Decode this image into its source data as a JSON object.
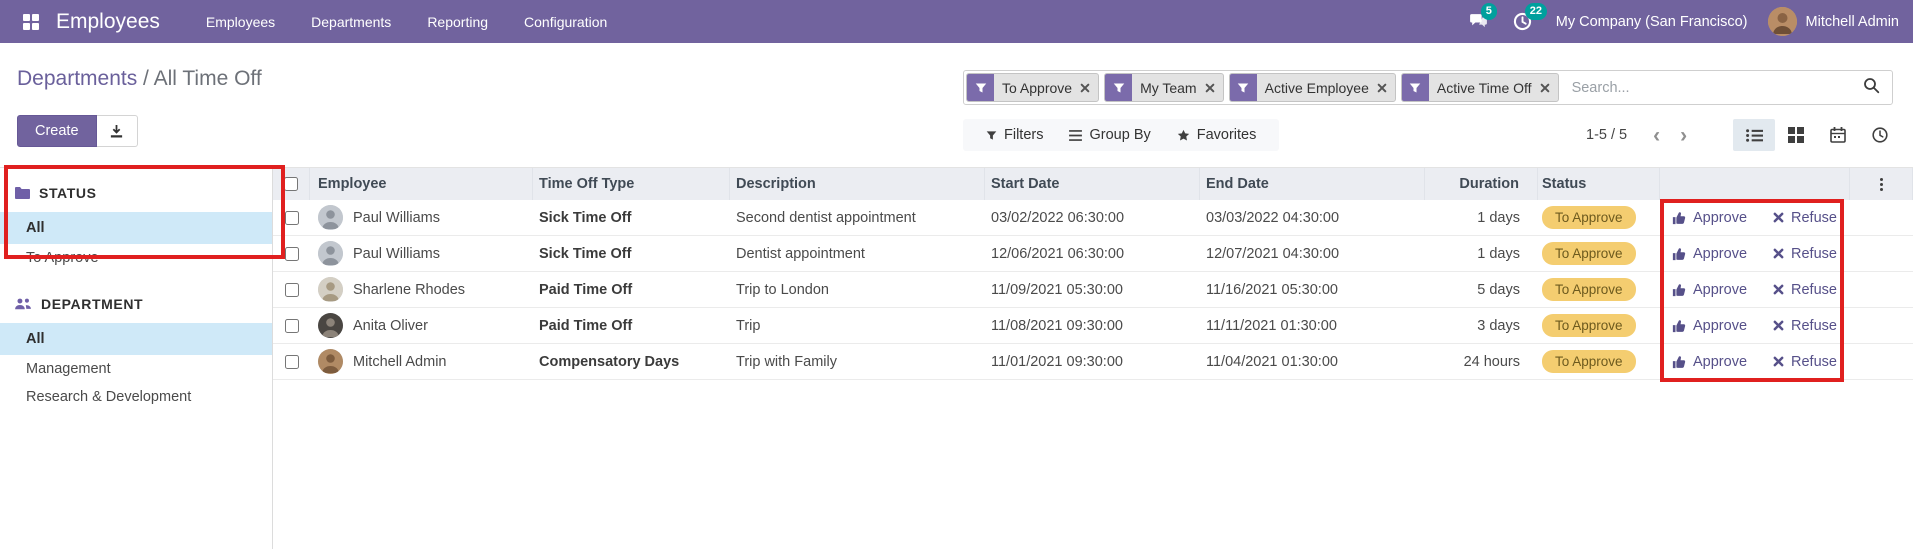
{
  "topbar": {
    "brand": "Employees",
    "menus": [
      "Employees",
      "Departments",
      "Reporting",
      "Configuration"
    ],
    "messages_count": "5",
    "activities_count": "22",
    "company": "My Company (San Francisco)",
    "user": "Mitchell Admin"
  },
  "breadcrumb": {
    "parent": "Departments",
    "separator": " / ",
    "current": "All Time Off"
  },
  "actions": {
    "create_label": "Create"
  },
  "search": {
    "placeholder": "Search...",
    "facets": [
      {
        "label": "To Approve"
      },
      {
        "label": "My Team"
      },
      {
        "label": "Active Employee"
      },
      {
        "label": "Active Time Off"
      }
    ]
  },
  "toolbar": {
    "filters": "Filters",
    "group_by": "Group By",
    "favorites": "Favorites",
    "pager_range": "1-5 / 5"
  },
  "sidebar": {
    "sections": [
      {
        "title": "STATUS",
        "icon": "folder-icon",
        "items": [
          {
            "label": "All",
            "active": true
          },
          {
            "label": "To Approve",
            "active": false
          }
        ]
      },
      {
        "title": "DEPARTMENT",
        "icon": "users-icon",
        "items": [
          {
            "label": "All",
            "active": true
          },
          {
            "label": "Management",
            "active": false
          },
          {
            "label": "Research & Development",
            "active": false
          }
        ]
      }
    ]
  },
  "table": {
    "columns": [
      "Employee",
      "Time Off Type",
      "Description",
      "Start Date",
      "End Date",
      "Duration",
      "Status"
    ],
    "row_actions": {
      "approve": "Approve",
      "refuse": "Refuse"
    },
    "rows": [
      {
        "employee": "Paul Williams",
        "type": "Sick Time Off",
        "description": "Second dentist appointment",
        "start": "03/02/2022 06:30:00",
        "end": "03/03/2022 04:30:00",
        "duration": "1 days",
        "status": "To Approve"
      },
      {
        "employee": "Paul Williams",
        "type": "Sick Time Off",
        "description": "Dentist appointment",
        "start": "12/06/2021 06:30:00",
        "end": "12/07/2021 04:30:00",
        "duration": "1 days",
        "status": "To Approve"
      },
      {
        "employee": "Sharlene Rhodes",
        "type": "Paid Time Off",
        "description": "Trip to London",
        "start": "11/09/2021 05:30:00",
        "end": "11/16/2021 05:30:00",
        "duration": "5 days",
        "status": "To Approve"
      },
      {
        "employee": "Anita Oliver",
        "type": "Paid Time Off",
        "description": "Trip",
        "start": "11/08/2021 09:30:00",
        "end": "11/11/2021 01:30:00",
        "duration": "3 days",
        "status": "To Approve"
      },
      {
        "employee": "Mitchell Admin",
        "type": "Compensatory Days",
        "description": "Trip with Family",
        "start": "11/01/2021 09:30:00",
        "end": "11/04/2021 01:30:00",
        "duration": "24 hours",
        "status": "To Approve"
      }
    ]
  },
  "icons": {
    "apps": "grid-2x2",
    "messages": "chat-bubbles",
    "activities": "clock",
    "filters": "funnel",
    "group_by": "bars",
    "favorites": "star",
    "search": "magnifier",
    "export": "download-tray",
    "approve": "thumbs-up",
    "refuse": "x-mark",
    "views": [
      "list",
      "kanban",
      "calendar",
      "clock"
    ]
  },
  "colors": {
    "topbar_purple": "#71639e",
    "badge_teal": "#00a09d",
    "status_badge_bg": "#f4cd70",
    "status_badge_text": "#6d5a1e",
    "active_item_blue": "#cfe9f8",
    "annotation_red": "#e0201f",
    "action_link_purple": "#565089"
  }
}
